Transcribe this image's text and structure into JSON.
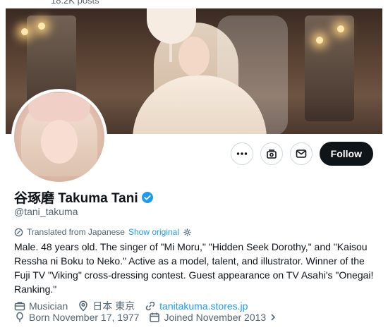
{
  "header": {
    "post_count": "18.2K posts"
  },
  "profile": {
    "display_name": "谷琢磨 Takuma Tani",
    "handle": "@tani_takuma",
    "verified": true
  },
  "actions": {
    "more_icon": "more-icon",
    "subscribe_icon": "subscribe-icon",
    "message_icon": "envelope-icon",
    "follow_label": "Follow"
  },
  "translation": {
    "label": "Translated from Japanese",
    "show_original": "Show original"
  },
  "bio": "Male. 48 years old. The singer of \"Mi Moru,\" \"Hidden Seek Dorothy,\" and \"Kaisou Ressha ni Boku to Neko.\" Active as a model, talent, and illustrator. Winner of the Fuji TV \"Viking\" cross-dressing contest. Guest appearance on TV Asahi's \"Onegai! Ranking.\"",
  "meta": {
    "profession": "Musician",
    "location": "日本 東京",
    "website": "tanitakuma.stores.jp",
    "born": "Born November 17, 1977",
    "joined": "Joined November 2013"
  },
  "colors": {
    "accent": "#1d9bf0",
    "follow_bg": "#0f1419",
    "secondary_text": "#536471"
  }
}
